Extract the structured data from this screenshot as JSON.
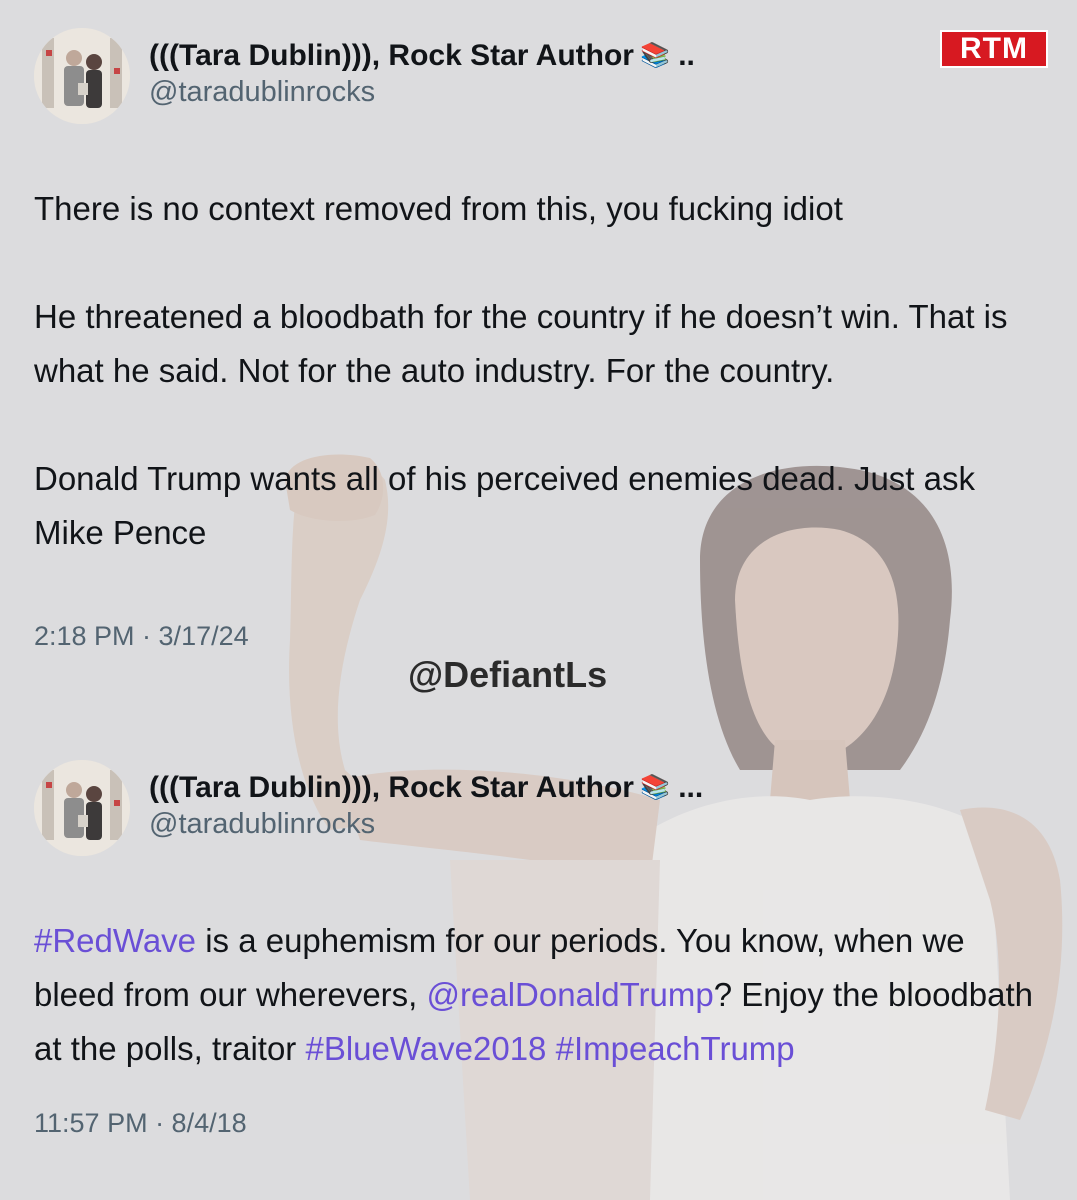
{
  "brand": {
    "logo_text": "RTM",
    "logo_color": "#d71921"
  },
  "watermark": "@DefiantLs",
  "tweets": [
    {
      "display_name": "(((Tara Dublin))), Rock Star Author",
      "name_icon": "books-icon",
      "name_truncation": "..",
      "handle": "@taradublinrocks",
      "paragraphs": [
        "There is no context removed from this, you fucking idiot",
        "He threatened a bloodbath for the country if he doesn’t win. That is what he said. Not for the auto industry. For the country.",
        "Donald Trump wants all of his perceived enemies dead. Just ask Mike Pence"
      ],
      "timestamp": "2:18 PM · 3/17/24"
    },
    {
      "display_name": "(((Tara Dublin))), Rock Star Author",
      "name_icon": "books-icon",
      "name_truncation": "...",
      "handle": "@taradublinrocks",
      "segments": {
        "tag_redwave": "#RedWave",
        "t1": " is a euphemism for our periods. You know, when we bleed from our wherevers, ",
        "mention_trump": "@realDonaldTrump",
        "t2": "? Enjoy the bloodbath at the polls, traitor ",
        "tag_bluewave": "#BlueWave2018",
        "t3": " ",
        "tag_impeach": "#ImpeachTrump"
      },
      "timestamp": "11:57 PM · 8/4/18"
    }
  ],
  "colors": {
    "background": "#dcdcde",
    "text": "#111418",
    "secondary_text": "#536471",
    "link": "#6a4fd6"
  }
}
